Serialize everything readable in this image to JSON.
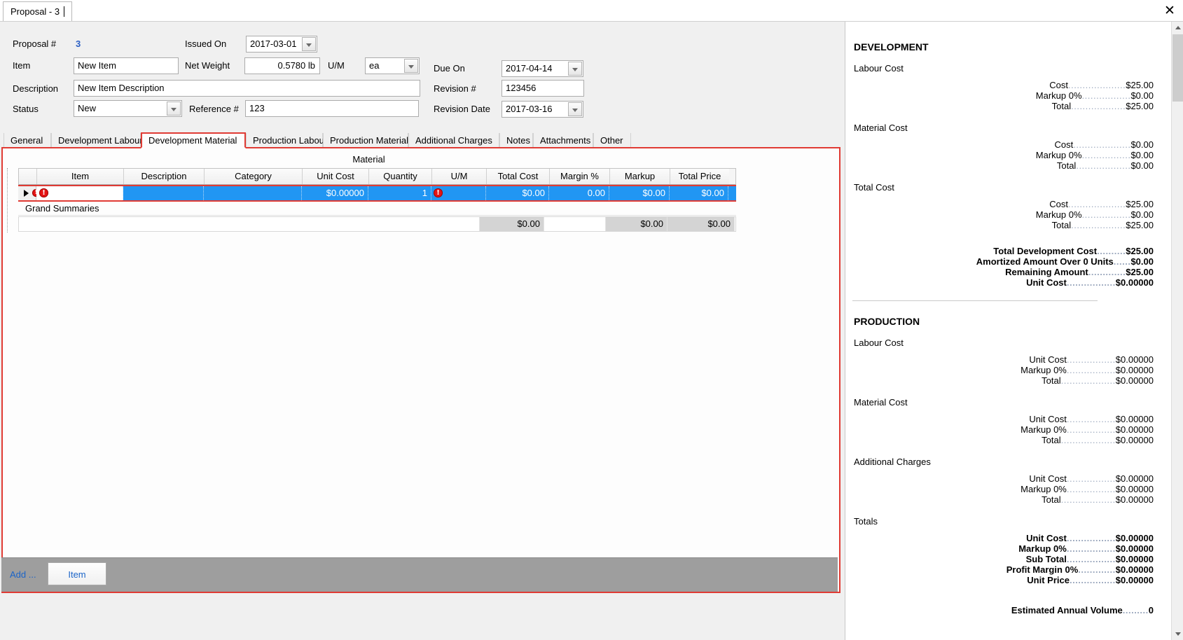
{
  "window": {
    "doc_tab_label": "Proposal - 3",
    "close_label": "✕"
  },
  "header": {
    "proposal_no_label": "Proposal #",
    "proposal_no_value": "3",
    "item_label": "Item",
    "item_value": "New Item",
    "description_label": "Description",
    "description_value": "New Item Description",
    "status_label": "Status",
    "status_value": "New",
    "issued_on_label": "Issued On",
    "issued_on_value": "2017-03-01",
    "net_weight_label": "Net Weight",
    "net_weight_value": "0.5780 lb",
    "um_label": "U/M",
    "um_value": "ea",
    "reference_label": "Reference #",
    "reference_value": "123",
    "due_on_label": "Due On",
    "due_on_value": "2017-04-14",
    "revision_no_label": "Revision #",
    "revision_no_value": "123456",
    "revision_date_label": "Revision Date",
    "revision_date_value": "2017-03-16"
  },
  "tabs": [
    {
      "label": "General",
      "active": false
    },
    {
      "label": "Development Labour",
      "active": false
    },
    {
      "label": "Development Material",
      "active": true
    },
    {
      "label": "Production Labour",
      "active": false
    },
    {
      "label": "Production Material",
      "active": false
    },
    {
      "label": "Additional Charges",
      "active": false
    },
    {
      "label": "Notes",
      "active": false
    },
    {
      "label": "Attachments",
      "active": false
    },
    {
      "label": "Other",
      "active": false
    }
  ],
  "grid": {
    "caption": "Material",
    "columns": [
      "Item",
      "Description",
      "Category",
      "Unit Cost",
      "Quantity",
      "U/M",
      "Total Cost",
      "Margin %",
      "Markup",
      "Total Price"
    ],
    "rows": [
      {
        "item": "",
        "item_error": "error-icon",
        "description": "",
        "category": "",
        "unit_cost": "$0.00000",
        "quantity": "1",
        "quantity_error": "error-icon",
        "um": "",
        "total_cost": "$0.00",
        "margin_pct": "0.00",
        "markup": "$0.00",
        "total_price": "$0.00"
      }
    ],
    "summary_label": "Grand Summaries",
    "summary": {
      "total_cost": "$0.00",
      "margin_pct": "",
      "markup": "$0.00",
      "total_price": "$0.00"
    }
  },
  "footer": {
    "add_label": "Add ...",
    "item_button_label": "Item"
  },
  "summary_pane": {
    "development": {
      "title": "DEVELOPMENT",
      "groups": [
        {
          "name": "Labour Cost",
          "lines": [
            {
              "label": "Cost",
              "value": "$25.00"
            },
            {
              "label": "Markup 0%",
              "value": "$0.00"
            },
            {
              "label": "Total",
              "value": "$25.00"
            }
          ]
        },
        {
          "name": "Material Cost",
          "lines": [
            {
              "label": "Cost",
              "value": "$0.00"
            },
            {
              "label": "Markup 0%",
              "value": "$0.00"
            },
            {
              "label": "Total",
              "value": "$0.00"
            }
          ]
        },
        {
          "name": "Total Cost",
          "lines": [
            {
              "label": "Cost",
              "value": "$25.00"
            },
            {
              "label": "Markup 0%",
              "value": "$0.00"
            },
            {
              "label": "Total",
              "value": "$25.00"
            }
          ]
        }
      ],
      "totals": [
        {
          "label": "Total Development Cost",
          "value": "$25.00"
        },
        {
          "label": "Amortized Amount Over 0 Units",
          "value": "$0.00"
        },
        {
          "label": "Remaining Amount",
          "value": "$25.00"
        },
        {
          "label": "Unit Cost",
          "value": "$0.00000"
        }
      ]
    },
    "production": {
      "title": "PRODUCTION",
      "groups": [
        {
          "name": "Labour Cost",
          "lines": [
            {
              "label": "Unit Cost",
              "value": "$0.00000"
            },
            {
              "label": "Markup 0%",
              "value": "$0.00000"
            },
            {
              "label": "Total",
              "value": "$0.00000"
            }
          ]
        },
        {
          "name": "Material Cost",
          "lines": [
            {
              "label": "Unit Cost",
              "value": "$0.00000"
            },
            {
              "label": "Markup 0%",
              "value": "$0.00000"
            },
            {
              "label": "Total",
              "value": "$0.00000"
            }
          ]
        },
        {
          "name": "Additional Charges",
          "lines": [
            {
              "label": "Unit Cost",
              "value": "$0.00000"
            },
            {
              "label": "Markup 0%",
              "value": "$0.00000"
            },
            {
              "label": "Total",
              "value": "$0.00000"
            }
          ]
        },
        {
          "name": "Totals",
          "lines": [
            {
              "label": "Unit Cost",
              "value": "$0.00000",
              "bold": true
            },
            {
              "label": "Markup 0%",
              "value": "$0.00000",
              "bold": true
            },
            {
              "label": "Sub Total",
              "value": "$0.00000",
              "bold": true
            },
            {
              "label": "Profit Margin 0%",
              "value": "$0.00000",
              "bold": true
            },
            {
              "label": "Unit Price",
              "value": "$0.00000",
              "bold": true
            }
          ]
        }
      ],
      "annual": {
        "label": "Estimated Annual Volume",
        "value": "0"
      }
    }
  },
  "colors": {
    "accent_red": "#e03b34",
    "row_select_blue": "#2196f3",
    "link_blue": "#1b64c8",
    "value_blue": "#2b5fc4",
    "dot_leader": "#9aa7bd"
  }
}
